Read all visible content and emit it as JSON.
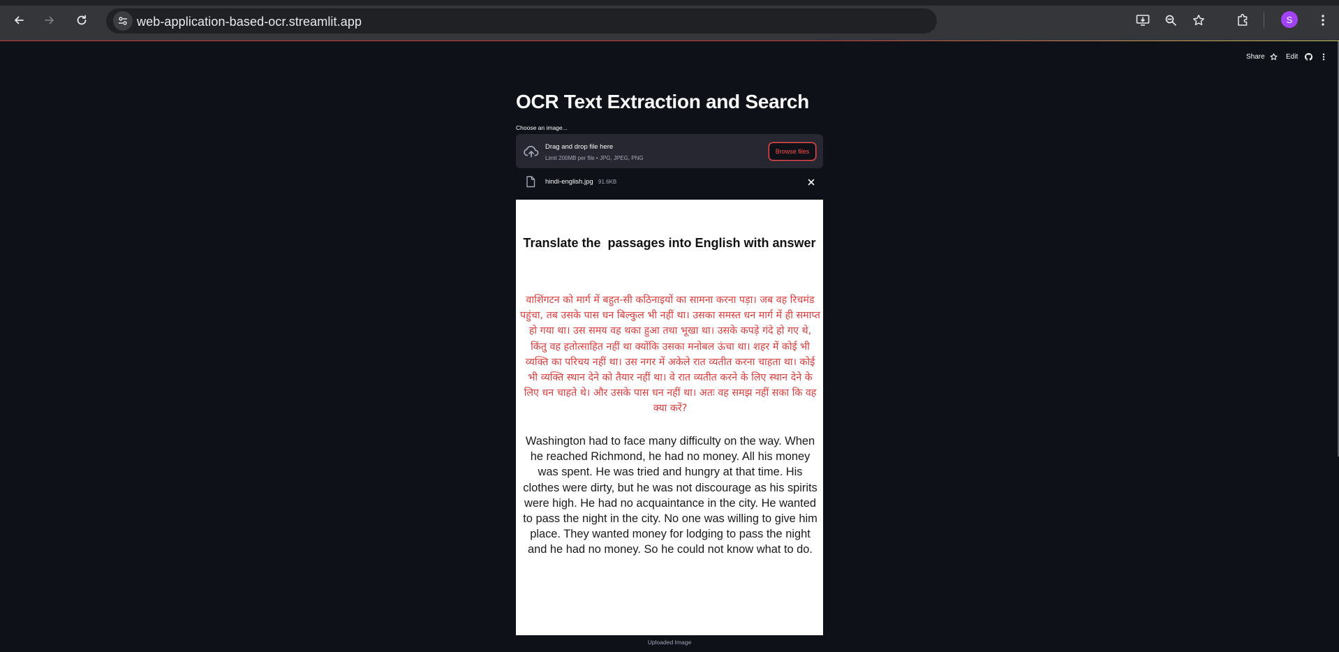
{
  "browser": {
    "url": "web-application-based-ocr.streamlit.app",
    "profile_initial": "S",
    "colors": {
      "chrome_bg": "#35363a",
      "omnibox_bg": "#202124",
      "avatar": "#a142f4"
    }
  },
  "header": {
    "share_label": "Share",
    "edit_label": "Edit"
  },
  "app": {
    "title": "OCR Text Extraction and Search",
    "uploader": {
      "label": "Choose an image...",
      "drop_text": "Drag and drop file here",
      "limit_text": "Limit 200MB per file • JPG, JPEG, PNG",
      "browse_label": "Browse files"
    },
    "file": {
      "name": "hindi-english.jpg",
      "size": "91.6KB"
    },
    "image": {
      "heading": "Translate the  passages into English with answer",
      "hindi_text": "वाशिंगटन को मार्ग में बहुत-सी कठिनाइयों का सामना करना पड़ा। जब वह रिचमंड पहुंचा, तब उसके पास धन बिल्कुल भी नहीं था। उसका समस्त धन मार्ग में ही समाप्त हो गया था। उस समय वह थका हुआ तथा भूखा था। उसके कपड़े गंदे हो गए थे, किंतु वह हतोत्साहित नहीं था क्योंकि उसका मनोबल ऊंचा था। शहर में कोई भी व्यक्ति का परिचय नहीं था। उस नगर में अकेले रात व्यतीत करना चाहता था। कोई भी व्यक्ति स्थान देने को तैयार नहीं  था। वे रात व्यतीत करने के लिए स्थान देने के लिए धन चाहते थे। और उसके पास धन नहीं था। अतः वह समझ नहीं सका कि वह क्या करें?",
      "english_text": "Washington had to face many difficulty on the way. When he reached Richmond, he had no money. All his money was spent. He was tried and hungry at that time. His clothes were dirty, but he was not discourage as his spirits were high. He had no acquaintance in the city. He wanted to pass the night in the city. No one was willing to give him place. They wanted money for lodging to pass the night and he had no money. So he could not know what to do.",
      "caption": "Uploaded Image"
    },
    "colors": {
      "bg": "#0e1117",
      "accent": "#ff4b4b",
      "hindi_text": "#d93b3b",
      "dropzone_bg": "#262730"
    }
  }
}
